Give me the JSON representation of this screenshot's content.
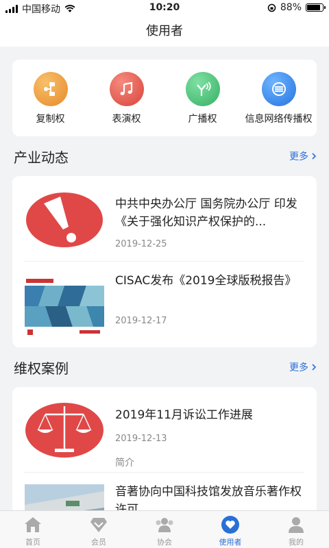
{
  "status_bar": {
    "carrier": "中国移动",
    "time": "10:20",
    "battery": "88%"
  },
  "nav": {
    "title": "使用者"
  },
  "rights": [
    {
      "label": "复制权",
      "icon": "copy-icon",
      "color": "#f0a040"
    },
    {
      "label": "表演权",
      "icon": "music-note-icon",
      "color": "#e65a50"
    },
    {
      "label": "广播权",
      "icon": "antenna-icon",
      "color": "#4cc47a"
    },
    {
      "label": "信息网络传播权",
      "icon": "network-icon",
      "color": "#3a8ef0"
    }
  ],
  "industry": {
    "title": "产业动态",
    "more": "更多",
    "items": [
      {
        "title": "中共中央办公厅 国务院办公厅 印发《关于强化知识产权保护的...",
        "date": "2019-12-25",
        "thumb": "exclamation-thumbnail"
      },
      {
        "title": "CISAC发布《2019全球版税报告》",
        "date": "2019-12-17",
        "thumb": "report-cover-thumbnail"
      }
    ]
  },
  "cases": {
    "title": "维权案例",
    "more": "更多",
    "items": [
      {
        "title": "2019年11月诉讼工作进展",
        "date": "2019-12-13",
        "desc": "简介",
        "thumb": "scales-thumbnail"
      },
      {
        "title": "音著协向中国科技馆发放音乐著作权许可",
        "thumb": "building-thumbnail"
      }
    ]
  },
  "tabs": [
    {
      "label": "首页",
      "icon": "home-icon"
    },
    {
      "label": "会员",
      "icon": "member-icon"
    },
    {
      "label": "协会",
      "icon": "association-icon"
    },
    {
      "label": "使用者",
      "icon": "heart-icon"
    },
    {
      "label": "我的",
      "icon": "profile-icon"
    }
  ],
  "active_tab": "使用者",
  "colors": {
    "accent": "#2a6fd8",
    "background": "#f2f3f5"
  }
}
